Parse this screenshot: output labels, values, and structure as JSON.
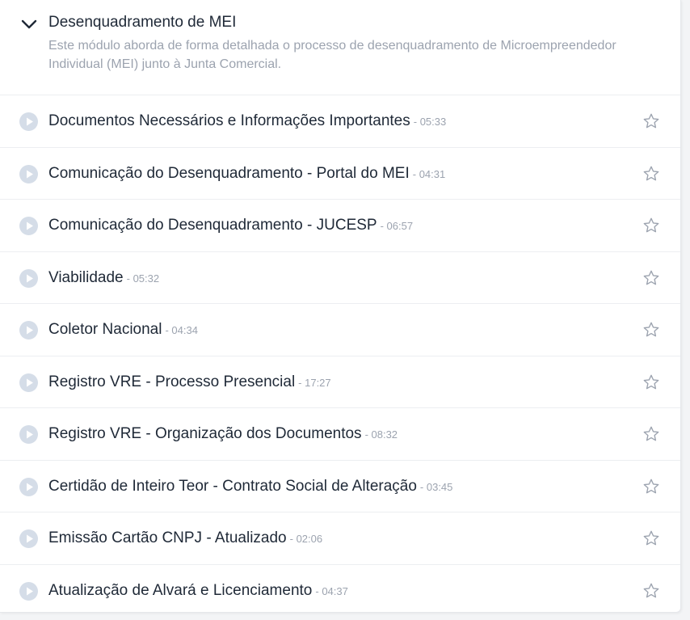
{
  "module": {
    "title": "Desenquadramento de MEI",
    "description": "Este módulo aborda de forma detalhada o processo de desenquadramento de Microempreendedor Individual (MEI) junto à Junta Comercial.",
    "expand_icon": "chevron-down-icon"
  },
  "colors": {
    "play_icon_bg": "#d5dde8",
    "play_icon_fg": "#ffffff",
    "star_icon": "#9ca3af",
    "title_text": "#1f2937",
    "muted_text": "#9ca3af"
  },
  "lessons": [
    {
      "title": "Documentos Necessários e Informações Importantes",
      "duration": "- 05:33"
    },
    {
      "title": "Comunicação do Desenquadramento - Portal do MEI",
      "duration": "- 04:31"
    },
    {
      "title": "Comunicação do Desenquadramento - JUCESP",
      "duration": "- 06:57"
    },
    {
      "title": "Viabilidade",
      "duration": "- 05:32"
    },
    {
      "title": "Coletor Nacional",
      "duration": "- 04:34"
    },
    {
      "title": "Registro VRE - Processo Presencial",
      "duration": "- 17:27"
    },
    {
      "title": "Registro VRE - Organização dos Documentos",
      "duration": "- 08:32"
    },
    {
      "title": "Certidão de Inteiro Teor - Contrato Social de Alteração",
      "duration": "- 03:45"
    },
    {
      "title": "Emissão Cartão CNPJ - Atualizado",
      "duration": "- 02:06"
    },
    {
      "title": "Atualização de Alvará e Licenciamento",
      "duration": "- 04:37"
    }
  ]
}
